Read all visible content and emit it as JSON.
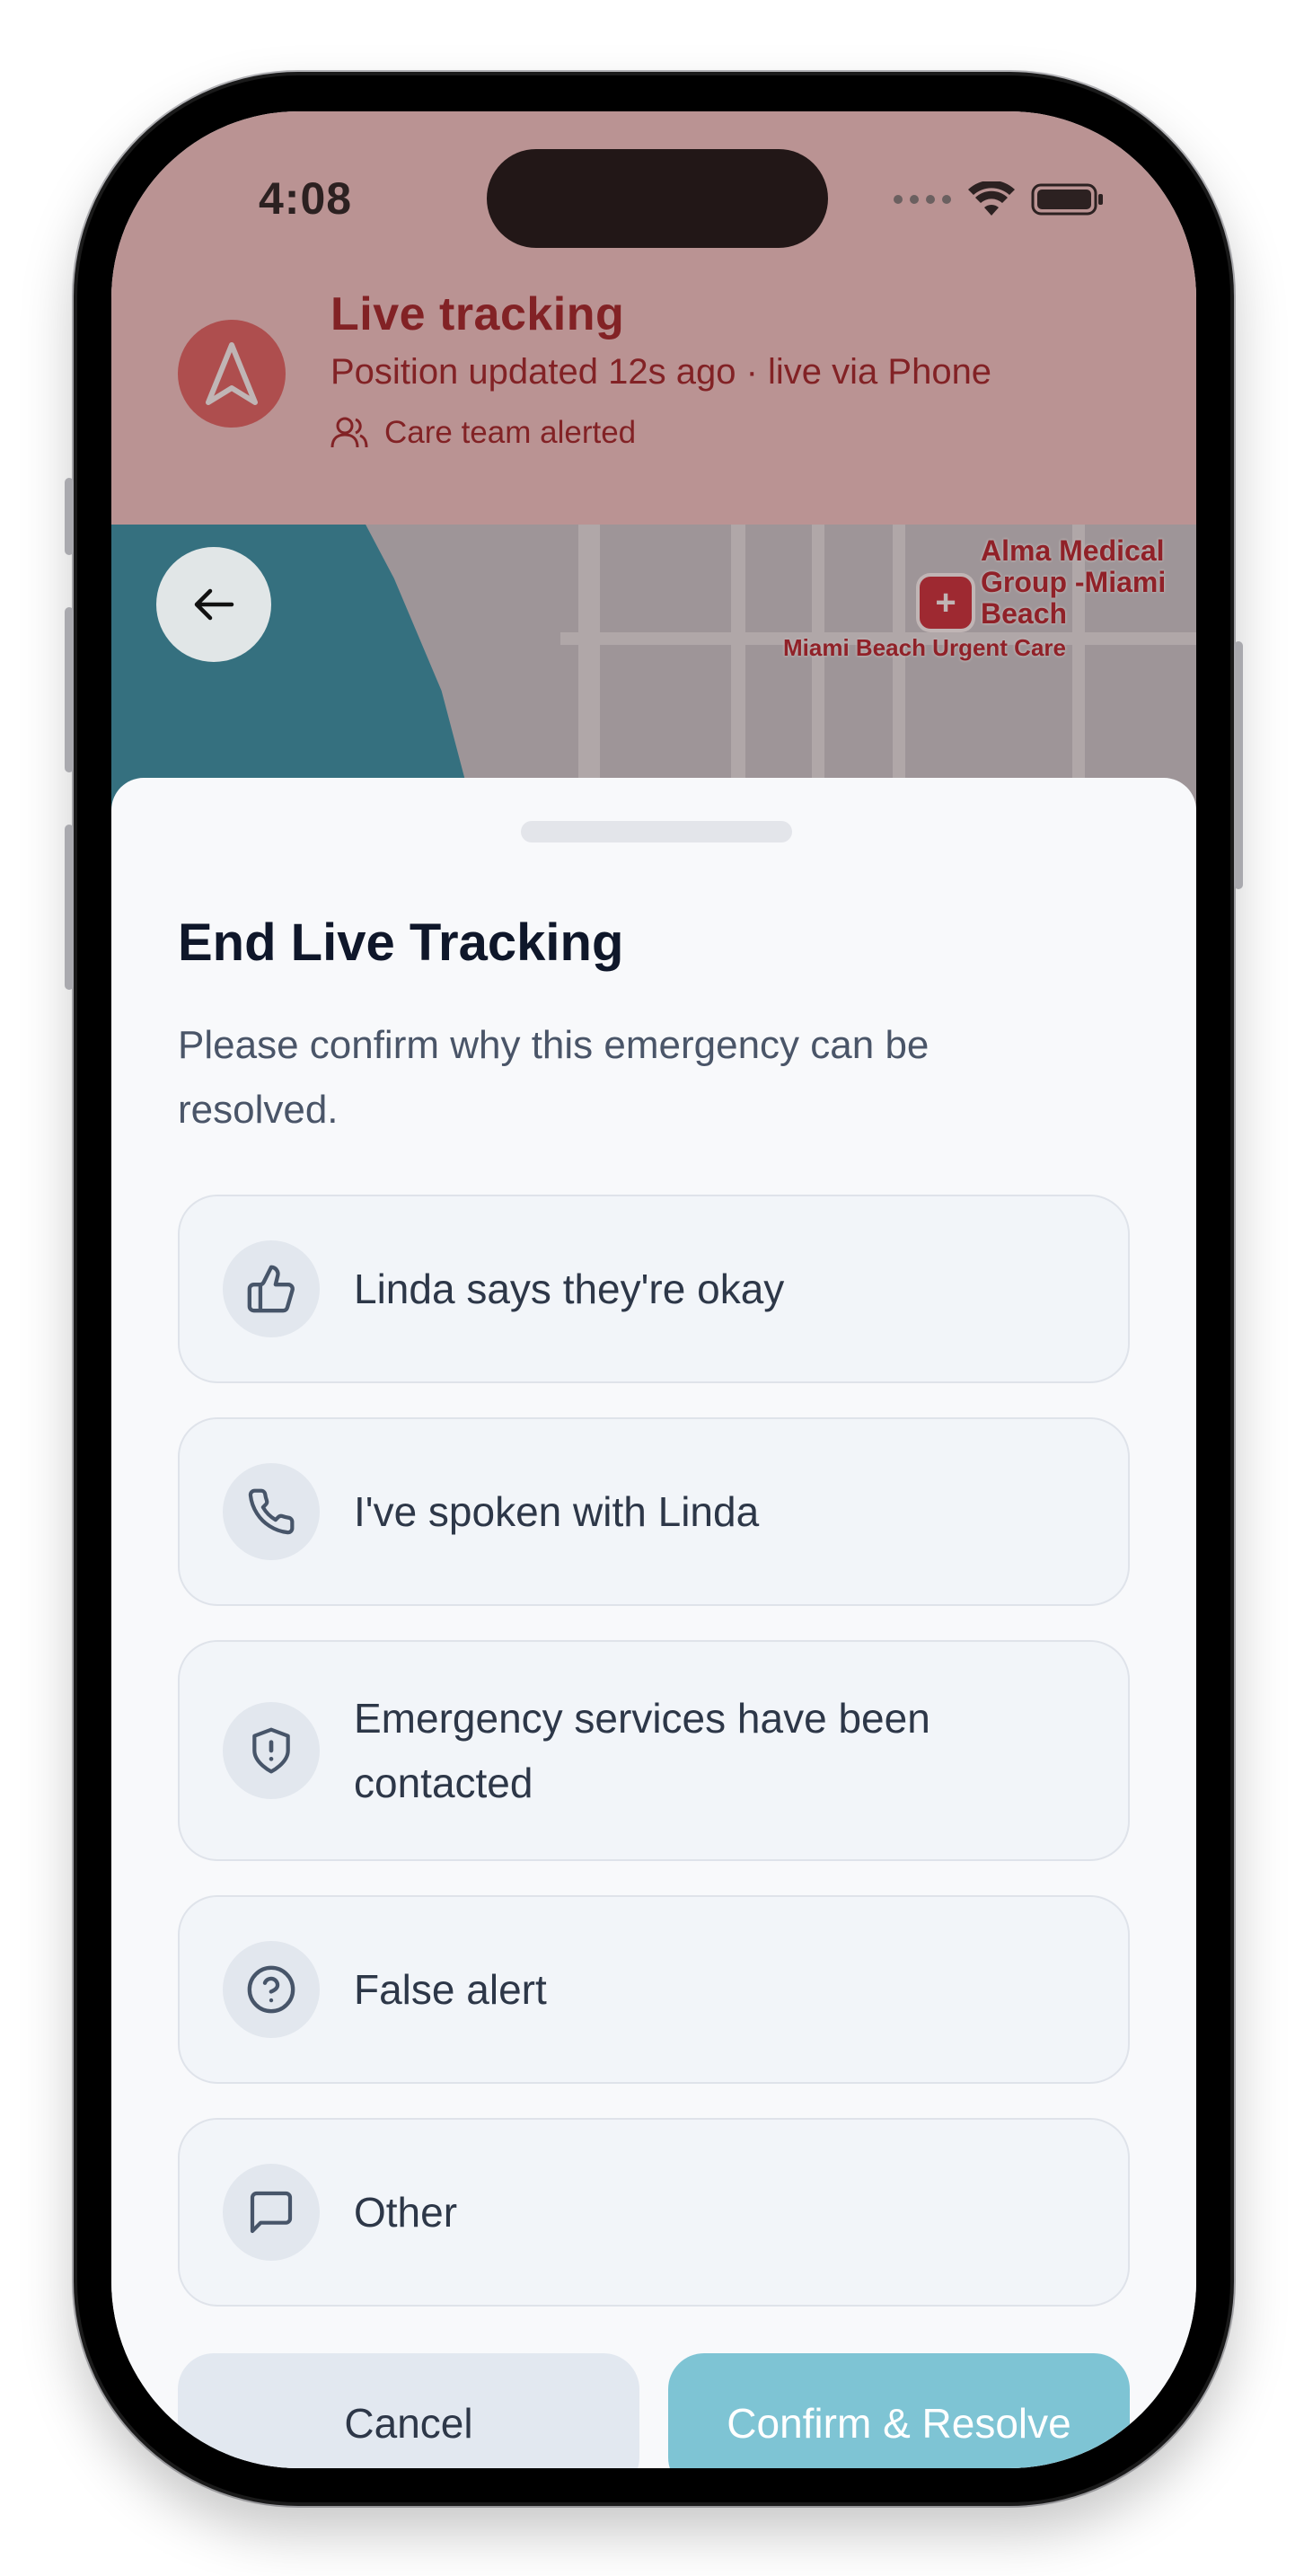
{
  "status_bar": {
    "time": "4:08"
  },
  "header": {
    "title": "Live tracking",
    "subtitle": "Position updated 12s ago · live via Phone",
    "care_status": "Care team alerted"
  },
  "map": {
    "place_name_line1": "Alma Medical",
    "place_name_line2": "Group -Miami",
    "place_name_line3": "Beach",
    "place_name_small": "Miami Beach Urgent Care"
  },
  "sheet": {
    "title": "End Live Tracking",
    "description": "Please confirm why this emergency can be resolved.",
    "options": [
      {
        "label": "Linda says they're okay",
        "icon": "thumbs-up-icon"
      },
      {
        "label": "I've spoken with Linda",
        "icon": "phone-icon"
      },
      {
        "label": "Emergency services have been contacted",
        "icon": "shield-alert-icon"
      },
      {
        "label": "False alert",
        "icon": "help-circle-icon"
      },
      {
        "label": "Other",
        "icon": "message-square-icon"
      }
    ],
    "cancel_label": "Cancel",
    "confirm_label": "Confirm & Resolve"
  },
  "colors": {
    "header_bg": "#f6c8c8",
    "alert_red": "#9c1218",
    "confirm_bg": "#7ec4d4",
    "cancel_bg": "#e2e8f0",
    "title_text": "#0f172a"
  }
}
